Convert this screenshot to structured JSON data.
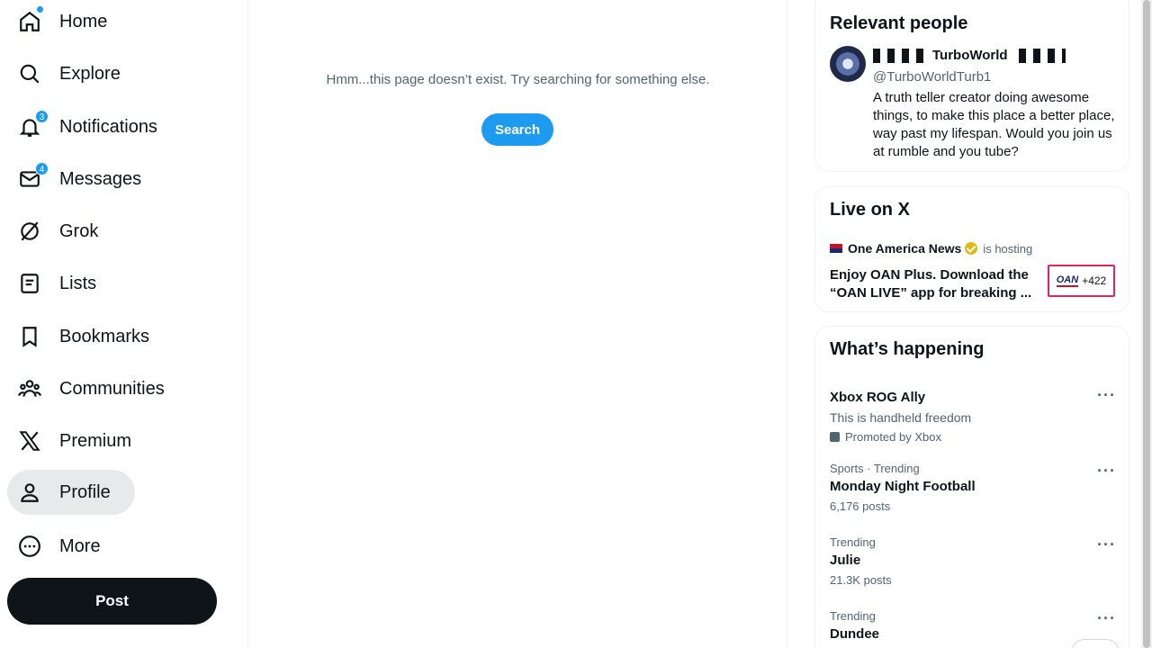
{
  "nav": {
    "items": [
      {
        "label": "Home",
        "icon": "home-icon"
      },
      {
        "label": "Explore",
        "icon": "search-icon"
      },
      {
        "label": "Notifications",
        "icon": "bell-icon",
        "badge": "3"
      },
      {
        "label": "Messages",
        "icon": "mail-icon",
        "badge": "4"
      },
      {
        "label": "Grok",
        "icon": "grok-icon"
      },
      {
        "label": "Lists",
        "icon": "list-icon"
      },
      {
        "label": "Bookmarks",
        "icon": "bookmark-icon"
      },
      {
        "label": "Communities",
        "icon": "people-icon"
      },
      {
        "label": "Premium",
        "icon": "x-logo-icon"
      },
      {
        "label": "Profile",
        "icon": "person-icon"
      },
      {
        "label": "More",
        "icon": "more-circle-icon"
      }
    ],
    "post_label": "Post"
  },
  "main": {
    "not_found_text": "Hmm...this page doesn’t exist. Try searching for something else.",
    "search_label": "Search"
  },
  "relevant_people": {
    "heading": "Relevant people",
    "name": "TurboWorld",
    "handle": "@TurboWorldTurb1",
    "bio": "A truth teller creator doing awesome things, to make this place a better place, way past my lifespan. Would you join us at rumble and you tube?"
  },
  "live": {
    "heading": "Live on X",
    "host_name": "One America News",
    "hosting_text": "is hosting",
    "title": "Enjoy OAN Plus. Download the “OAN LIVE” app for breaking ...",
    "thumb_logo": "OAN",
    "listeners": "+422"
  },
  "happening": {
    "heading": "What’s happening",
    "trends": [
      {
        "meta": "",
        "title": "Xbox ROG Ally",
        "desc": "This is handheld freedom",
        "promoted": "Promoted by Xbox"
      },
      {
        "meta": "Sports · Trending",
        "title": "Monday Night Football",
        "sub": "6,176 posts"
      },
      {
        "meta": "Trending",
        "title": "Julie",
        "sub": "21.3K posts"
      },
      {
        "meta": "Trending",
        "title": "Dundee",
        "sub": ""
      }
    ]
  },
  "colors": {
    "accent": "#1d9bf0",
    "text": "#0f1419",
    "secondary": "#536471"
  }
}
